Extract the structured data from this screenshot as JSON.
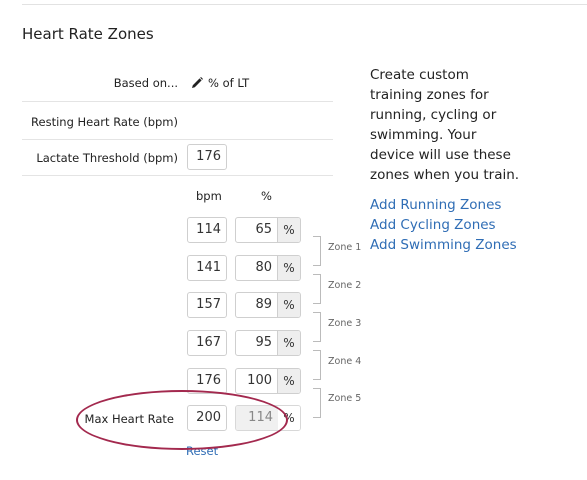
{
  "page": {
    "title": "Heart Rate Zones"
  },
  "settings": {
    "based_on_label": "Based on...",
    "based_on_value": "% of LT",
    "resting_hr_label": "Resting Heart Rate (bpm)",
    "lactate_threshold_label": "Lactate Threshold (bpm)",
    "lactate_threshold_value": "176"
  },
  "columns": {
    "bpm": "bpm",
    "percent": "%"
  },
  "zones": [
    {
      "bpm": "114",
      "percent": "65",
      "unit": "%"
    },
    {
      "bpm": "141",
      "percent": "80",
      "unit": "%"
    },
    {
      "bpm": "157",
      "percent": "89",
      "unit": "%"
    },
    {
      "bpm": "167",
      "percent": "95",
      "unit": "%"
    },
    {
      "bpm": "176",
      "percent": "100",
      "unit": "%"
    }
  ],
  "zone_labels": [
    "Zone 1",
    "Zone 2",
    "Zone 3",
    "Zone 4",
    "Zone 5"
  ],
  "max_hr": {
    "label": "Max Heart Rate",
    "bpm": "200",
    "percent": "114",
    "unit": "%"
  },
  "reset_label": "Reset",
  "info_text": "Create custom training zones for running, cycling or swimming. Your device will use these zones when you train.",
  "links": {
    "running": "Add Running Zones",
    "cycling": "Add Cycling Zones",
    "swimming": "Add Swimming Zones"
  },
  "colors": {
    "link": "#2f6db5",
    "highlight": "#a3294e"
  },
  "icons": {
    "edit": "pencil-icon"
  }
}
